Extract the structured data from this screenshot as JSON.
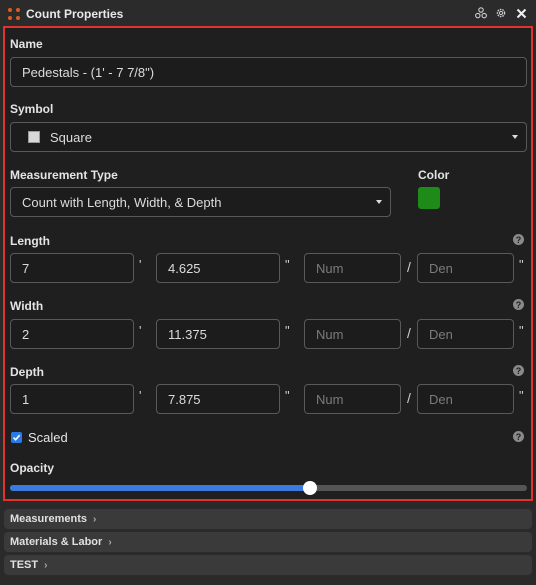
{
  "window": {
    "title": "Count Properties",
    "icons": [
      "hierarchy-icon",
      "gear-icon",
      "close-icon"
    ]
  },
  "form": {
    "name_label": "Name",
    "name_value": "Pedestals - (1' - 7 7/8\")",
    "symbol_label": "Symbol",
    "symbol_value": "Square",
    "measurement_type_label": "Measurement Type",
    "measurement_type_value": "Count with Length, Width, & Depth",
    "color_label": "Color",
    "color_value": "#1e8a18",
    "foot_mark": "'",
    "inch_mark": "\"",
    "fraction_sep": "/",
    "num_placeholder": "Num",
    "den_placeholder": "Den",
    "length": {
      "label": "Length",
      "feet": "7",
      "inches": "4.625"
    },
    "width": {
      "label": "Width",
      "feet": "2",
      "inches": "11.375"
    },
    "depth": {
      "label": "Depth",
      "feet": "1",
      "inches": "7.875"
    },
    "scaled_label": "Scaled",
    "scaled_checked": true,
    "opacity_label": "Opacity",
    "opacity_fraction": 0.58
  },
  "sections": [
    {
      "label": "Measurements"
    },
    {
      "label": "Materials & Labor"
    },
    {
      "label": "TEST"
    }
  ]
}
